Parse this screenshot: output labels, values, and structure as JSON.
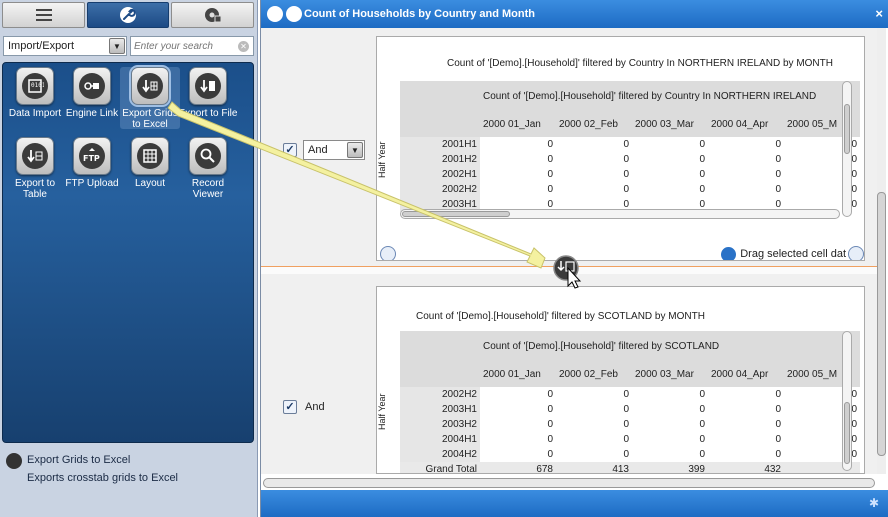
{
  "left": {
    "category": "Import/Export",
    "search_placeholder": "Enter your search",
    "tools": [
      {
        "label": "Data Import",
        "icon": "data-import-icon"
      },
      {
        "label": "Engine Link",
        "icon": "engine-link-icon"
      },
      {
        "label": "Export Grids to Excel",
        "icon": "export-grids-excel-icon"
      },
      {
        "label": "Export to File",
        "icon": "export-file-icon"
      },
      {
        "label": "Export to Table",
        "icon": "export-table-icon"
      },
      {
        "label": "FTP Upload",
        "icon": "ftp-upload-icon"
      },
      {
        "label": "Layout",
        "icon": "layout-icon"
      },
      {
        "label": "Record Viewer",
        "icon": "record-viewer-icon"
      }
    ],
    "info_title": "Export Grids to Excel",
    "info_desc": "Exports crosstab grids to Excel"
  },
  "window": {
    "title": "Count of Households by Country and Month",
    "close": "×",
    "drag_hint": "Drag selected cell dat"
  },
  "top_pane": {
    "operator": "And",
    "caption": "Count of '[Demo].[Household]' filtered by Country In NORTHERN IRELAND by MONTH",
    "y_title": "Half Year",
    "header_title": "Count of '[Demo].[Household]' filtered by Country In NORTHERN IRELAND",
    "columns": [
      "2000 01_Jan",
      "2000 02_Feb",
      "2000 03_Mar",
      "2000 04_Apr",
      "2000 05_M"
    ],
    "rows": [
      {
        "label": "2001H1",
        "values": [
          "0",
          "0",
          "0",
          "0",
          "0"
        ]
      },
      {
        "label": "2001H2",
        "values": [
          "0",
          "0",
          "0",
          "0",
          "0"
        ]
      },
      {
        "label": "2002H1",
        "values": [
          "0",
          "0",
          "0",
          "0",
          "0"
        ]
      },
      {
        "label": "2002H2",
        "values": [
          "0",
          "0",
          "0",
          "0",
          "0"
        ]
      },
      {
        "label": "2003H1",
        "values": [
          "0",
          "0",
          "0",
          "0",
          "0"
        ]
      }
    ]
  },
  "bottom_pane": {
    "operator": "And",
    "caption": "Count of '[Demo].[Household]' filtered by SCOTLAND by MONTH",
    "y_title": "Half Year",
    "header_title": "Count of '[Demo].[Household]' filtered by SCOTLAND",
    "columns": [
      "2000 01_Jan",
      "2000 02_Feb",
      "2000 03_Mar",
      "2000 04_Apr",
      "2000 05_M"
    ],
    "rows": [
      {
        "label": "2002H2",
        "values": [
          "0",
          "0",
          "0",
          "0",
          "0"
        ]
      },
      {
        "label": "2003H1",
        "values": [
          "0",
          "0",
          "0",
          "0",
          "0"
        ]
      },
      {
        "label": "2003H2",
        "values": [
          "0",
          "0",
          "0",
          "0",
          "0"
        ]
      },
      {
        "label": "2004H1",
        "values": [
          "0",
          "0",
          "0",
          "0",
          "0"
        ]
      },
      {
        "label": "2004H2",
        "values": [
          "0",
          "0",
          "0",
          "0",
          "0"
        ]
      },
      {
        "label": "Grand Total",
        "values": [
          "678",
          "413",
          "399",
          "432",
          ""
        ]
      }
    ]
  },
  "colors": {
    "accent": "#1d6bc3",
    "tool_panel": "#1b4f8a",
    "arrow": "#f4f1a0"
  }
}
